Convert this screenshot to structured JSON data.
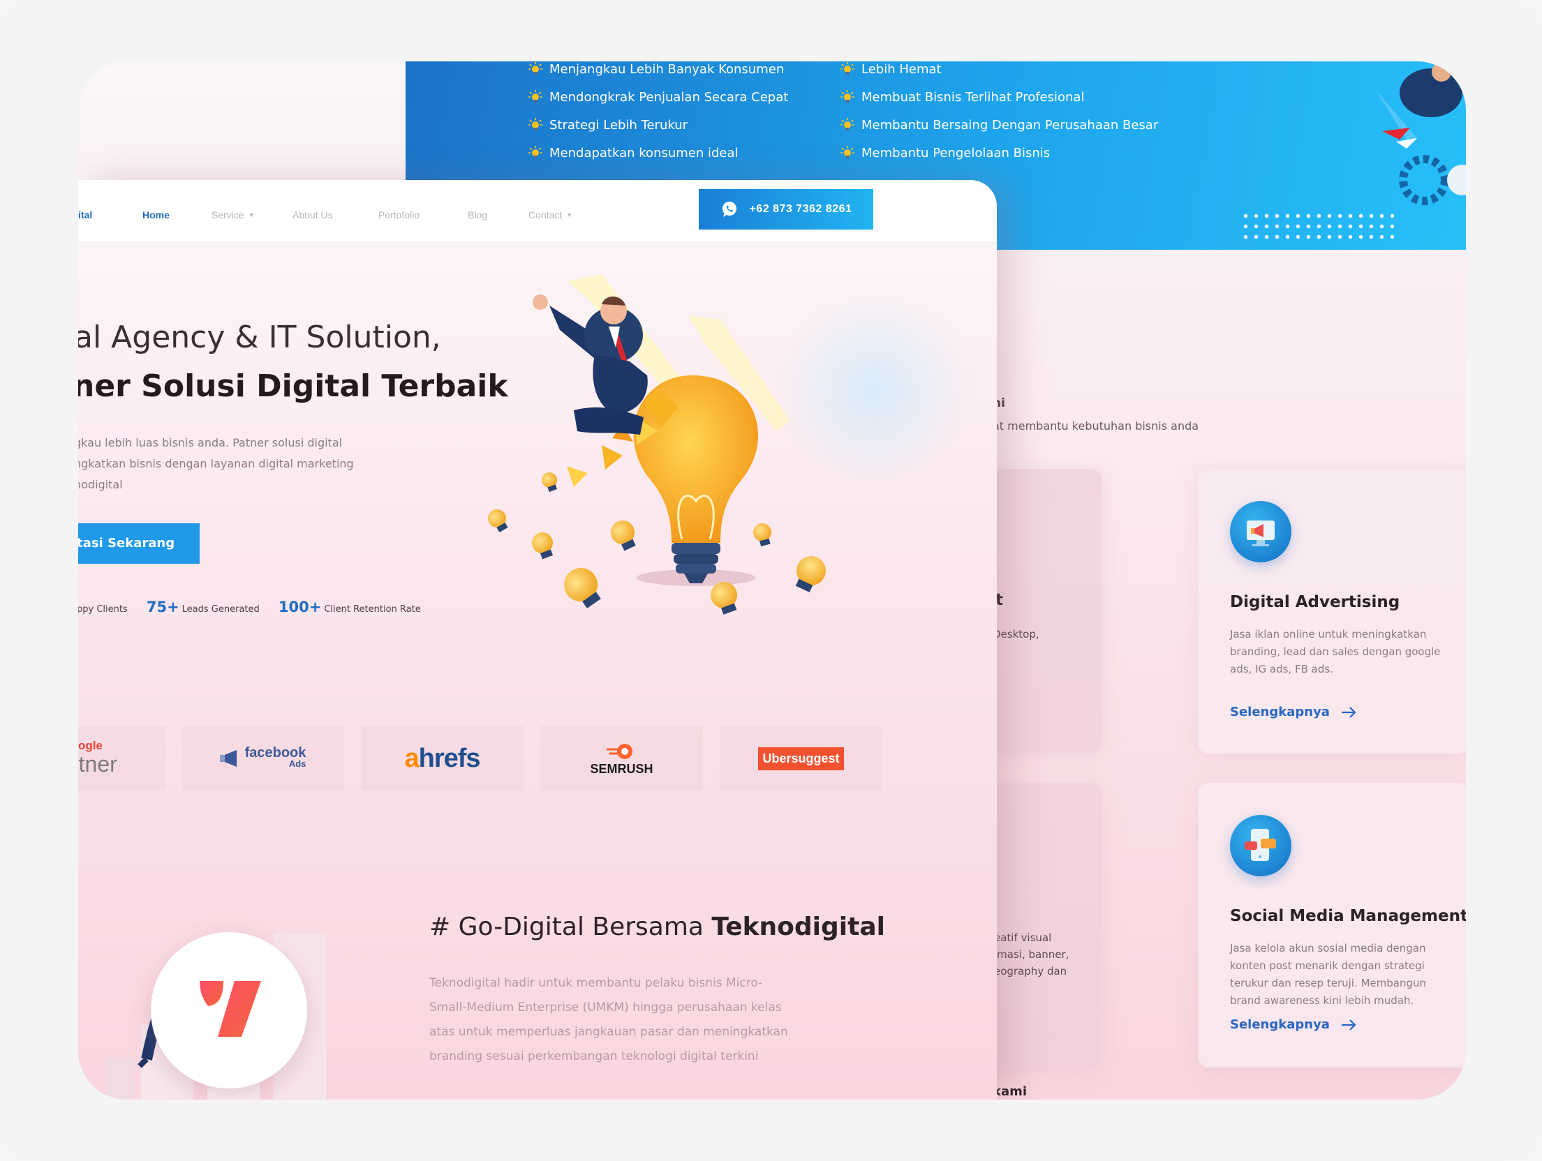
{
  "banner": {
    "features_left": [
      "Menjangkau Lebih Banyak Konsumen",
      "Mendongkrak Penjualan Secara Cepat",
      "Strategi Lebih Terukur",
      "Mendapatkan konsumen ideal"
    ],
    "features_right": [
      "Lebih Hemat",
      "Membuat Bisnis Terlihat Profesional",
      "Membantu Bersaing Dengan Perusahaan Besar",
      "Membantu Pengelolaan Bisnis"
    ],
    "bullet_icon": "lightbulb-icon"
  },
  "nav": {
    "logo": "ital",
    "items": [
      "Home",
      "Service",
      "About Us",
      "Portofolio",
      "Blog",
      "Contact"
    ],
    "active": "Home",
    "phone": "+62 873 7362 8261",
    "phone_icon": "whatsapp-icon"
  },
  "hero": {
    "line1": "al Agency & IT Solution,",
    "line2": "ner Solusi Digital Terbaik",
    "desc": [
      "gkau lebih luas bisnis anda. Patner solusi digital",
      "ngkatkan bisnis dengan layanan digital marketing",
      "nodigital"
    ],
    "cta": "ltasi Sekarang",
    "stats": [
      {
        "num": "",
        "label": "ppy Clients"
      },
      {
        "num": "75+",
        "label": "Leads Generated"
      },
      {
        "num": "100+",
        "label": "Client Retention Rate"
      }
    ]
  },
  "partners": {
    "google_top": "ogle",
    "google_bottom": "rtner",
    "facebook": "facebook",
    "facebook_sub": "Ads",
    "ahrefs_a": "a",
    "ahrefs_rest": "hrefs",
    "semrush": "SEMRUSH",
    "ubersuggest": "Ubersuggest"
  },
  "about": {
    "title_prefix": "# Go-Digital Bersama ",
    "title_bold": "Teknodigital",
    "desc": [
      "Teknodigital hadir untuk membantu pelaku bisnis Micro-",
      "Small-Medium Enterprise (UMKM) hingga perusahaan kelas",
      "atas untuk memperluas jangkauan pasar dan meningkatkan",
      "branding sesuai perkembangan teknologi digital terkini"
    ]
  },
  "services": {
    "heading": "ni",
    "sub": "at membantu kebutuhan bisnis anda",
    "ghost_top_title": "t",
    "ghost_top_desc": "Desktop,",
    "ghost_bottom_desc": [
      "eatif visual",
      "imasi, banner,",
      "eography dan"
    ],
    "cards": [
      {
        "title": "Digital Advertising",
        "desc": "Jasa iklan online untuk meningkatkan branding, lead dan sales dengan google ads, IG ads, FB ads.",
        "link": "Selengkapnya",
        "icon": "megaphone-monitor-icon"
      },
      {
        "title": "Social Media Management",
        "desc": "Jasa kelola akun sosial media dengan konten post menarik dengan strategi terukur dan resep teruji. Membangun brand awareness kini lebih mudah.",
        "link": "Selengkapnya",
        "icon": "smartphone-chat-icon"
      }
    ],
    "bottom_heading": "kami"
  },
  "colors": {
    "brand_blue": "#1f6dc2",
    "banner_blue": "#1ea4ec",
    "accent_yellow": "#f7b523",
    "brand_logo": "#ef3f6a"
  }
}
